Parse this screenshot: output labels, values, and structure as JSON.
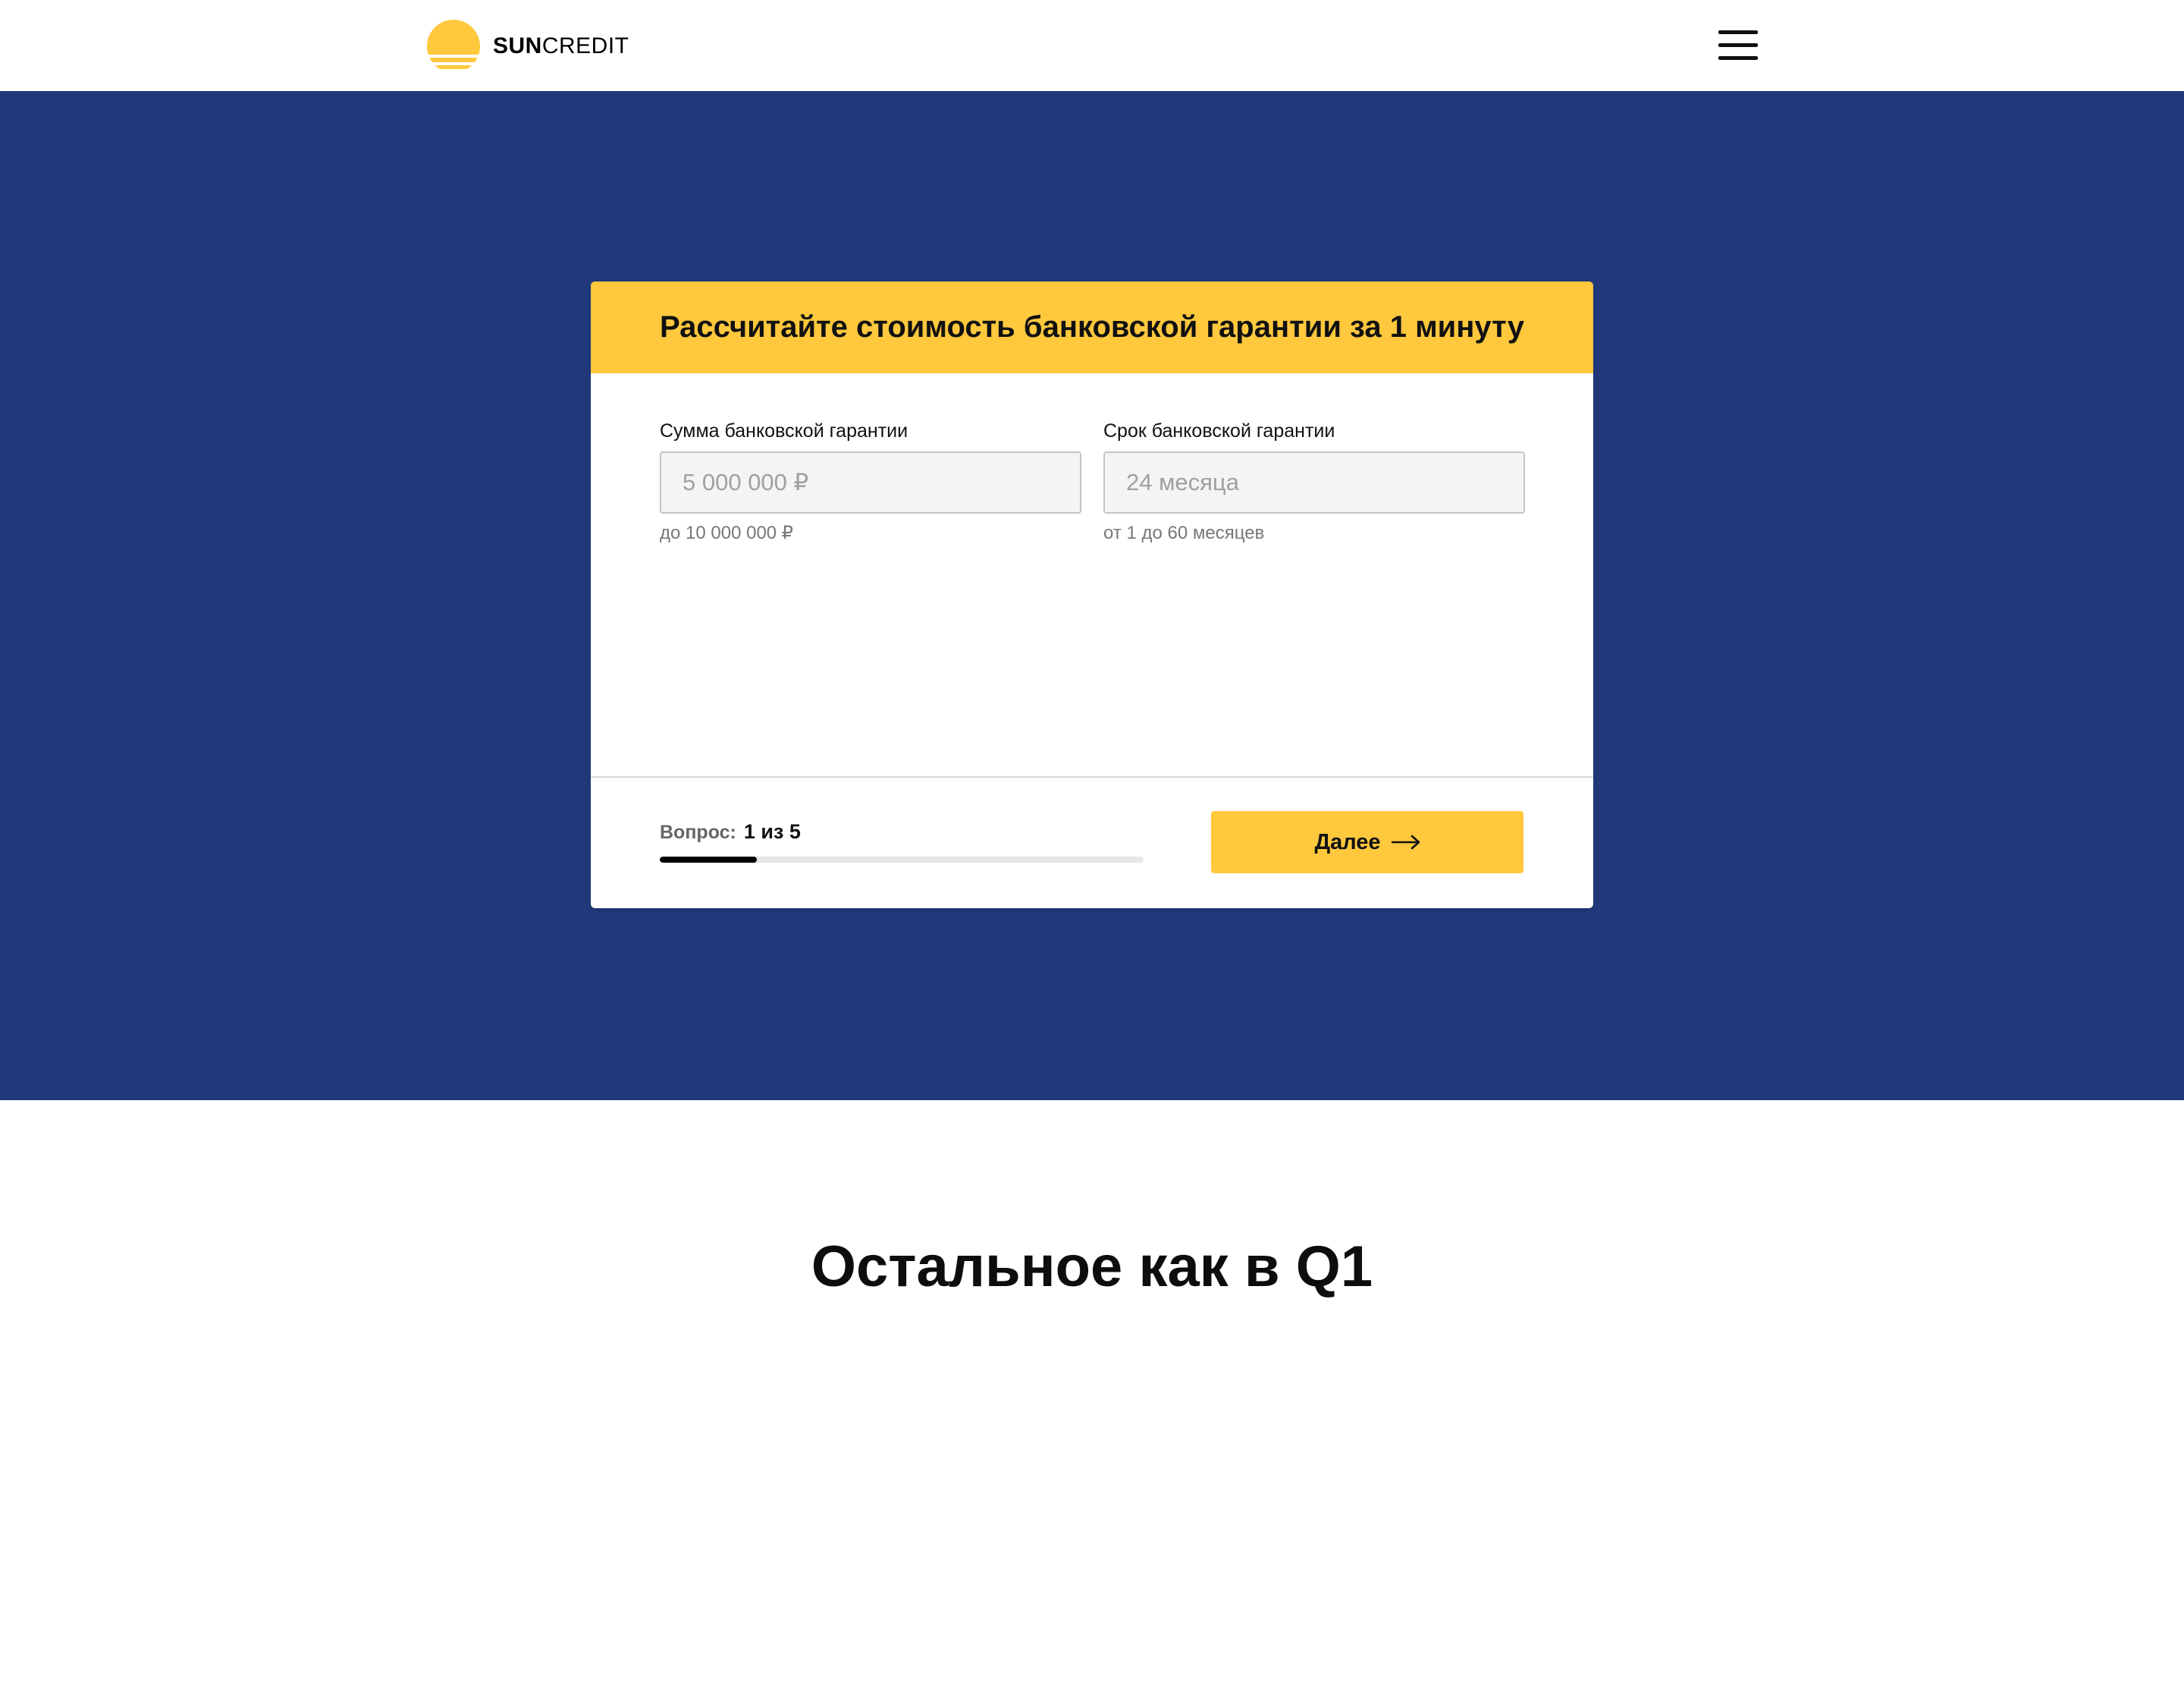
{
  "brand": {
    "sun": "SUN",
    "credit": "CREDIT",
    "logo_color": "#ffc83d"
  },
  "header": {
    "menu_icon": "hamburger-icon"
  },
  "colors": {
    "hero_bg": "#20397b",
    "accent": "#ffc83d",
    "progress_fill": "#000000"
  },
  "calculator": {
    "title": "Рассчитайте стоимость банковской гарантии за 1 минуту",
    "amount": {
      "label": "Сумма банковской гарантии",
      "placeholder": "5 000 000 ₽",
      "hint": "до 10 000 000 ₽"
    },
    "term": {
      "label": "Срок банковской гарантии",
      "placeholder": "24 месяца",
      "hint": "от 1 до 60 месяцев"
    },
    "progress": {
      "label": "Вопрос:",
      "value": "1 из 5",
      "fraction": 0.2
    },
    "next_button": {
      "label": "Далее",
      "icon": "arrow-right-icon"
    }
  },
  "bottom": {
    "heading": "Остальное как в Q1"
  }
}
